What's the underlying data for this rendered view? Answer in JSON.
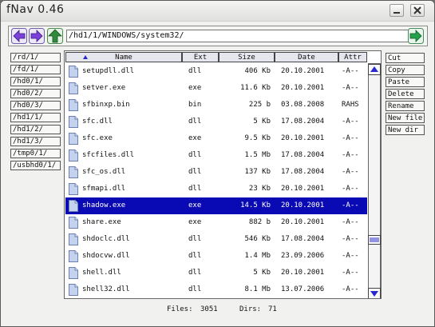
{
  "window": {
    "title": "fNav 0.46"
  },
  "path": {
    "value": "/hd1/1/WINDOWS/system32/"
  },
  "bookmarks": [
    "/rd/1/",
    "/fd/1/",
    "/hd0/1/",
    "/hd0/2/",
    "/hd0/3/",
    "/hd1/1/",
    "/hd1/2/",
    "/hd1/3/",
    "/tmp0/1/",
    "/usbhd0/1/"
  ],
  "actions": [
    "Cut",
    "Copy",
    "Paste",
    "Delete",
    "Rename",
    "New file",
    "New dir"
  ],
  "columns": {
    "name": "Name",
    "ext": "Ext",
    "size": "Size",
    "date": "Date",
    "attr": "Attr"
  },
  "files": [
    {
      "name": "setupdll.dll",
      "ext": "dll",
      "size": "406 Kb",
      "date": "20.10.2001",
      "attr": "-A--"
    },
    {
      "name": "setver.exe",
      "ext": "exe",
      "size": "11.6 Kb",
      "date": "20.10.2001",
      "attr": "-A--"
    },
    {
      "name": "sfbinxp.bin",
      "ext": "bin",
      "size": "225  b",
      "date": "03.08.2008",
      "attr": "RAHS"
    },
    {
      "name": "sfc.dll",
      "ext": "dll",
      "size": "5 Kb",
      "date": "17.08.2004",
      "attr": "-A--"
    },
    {
      "name": "sfc.exe",
      "ext": "exe",
      "size": "9.5 Kb",
      "date": "20.10.2001",
      "attr": "-A--"
    },
    {
      "name": "sfcfiles.dll",
      "ext": "dll",
      "size": "1.5 Mb",
      "date": "17.08.2004",
      "attr": "-A--"
    },
    {
      "name": "sfc_os.dll",
      "ext": "dll",
      "size": "137 Kb",
      "date": "17.08.2004",
      "attr": "-A--"
    },
    {
      "name": "sfmapi.dll",
      "ext": "dll",
      "size": "23 Kb",
      "date": "20.10.2001",
      "attr": "-A--"
    },
    {
      "name": "shadow.exe",
      "ext": "exe",
      "size": "14.5 Kb",
      "date": "20.10.2001",
      "attr": "-A--"
    },
    {
      "name": "share.exe",
      "ext": "exe",
      "size": "882  b",
      "date": "20.10.2001",
      "attr": "-A--"
    },
    {
      "name": "shdoclc.dll",
      "ext": "dll",
      "size": "546 Kb",
      "date": "17.08.2004",
      "attr": "-A--"
    },
    {
      "name": "shdocvw.dll",
      "ext": "dll",
      "size": "1.4 Mb",
      "date": "23.09.2006",
      "attr": "-A--"
    },
    {
      "name": "shell.dll",
      "ext": "dll",
      "size": "5 Kb",
      "date": "20.10.2001",
      "attr": "-A--"
    },
    {
      "name": "shell32.dll",
      "ext": "dll",
      "size": "8.1 Mb",
      "date": "13.07.2006",
      "attr": "-A--"
    }
  ],
  "selected_file": "shadow.exe",
  "status": {
    "files_label": "Files:",
    "files_count": "3051",
    "dirs_label": "Dirs:",
    "dirs_count": "71"
  },
  "colors": {
    "selection": "#0a0ab4",
    "back_arrow": "#7a40d8",
    "up_arrow": "#2f8a3a",
    "go_arrow": "#23a04a",
    "scroll_arrow": "#2a2acc"
  },
  "icons": {
    "back": "arrow-left-icon",
    "forward": "arrow-right-icon",
    "up": "arrow-up-icon",
    "go": "go-arrow-icon",
    "file": "file-icon"
  }
}
